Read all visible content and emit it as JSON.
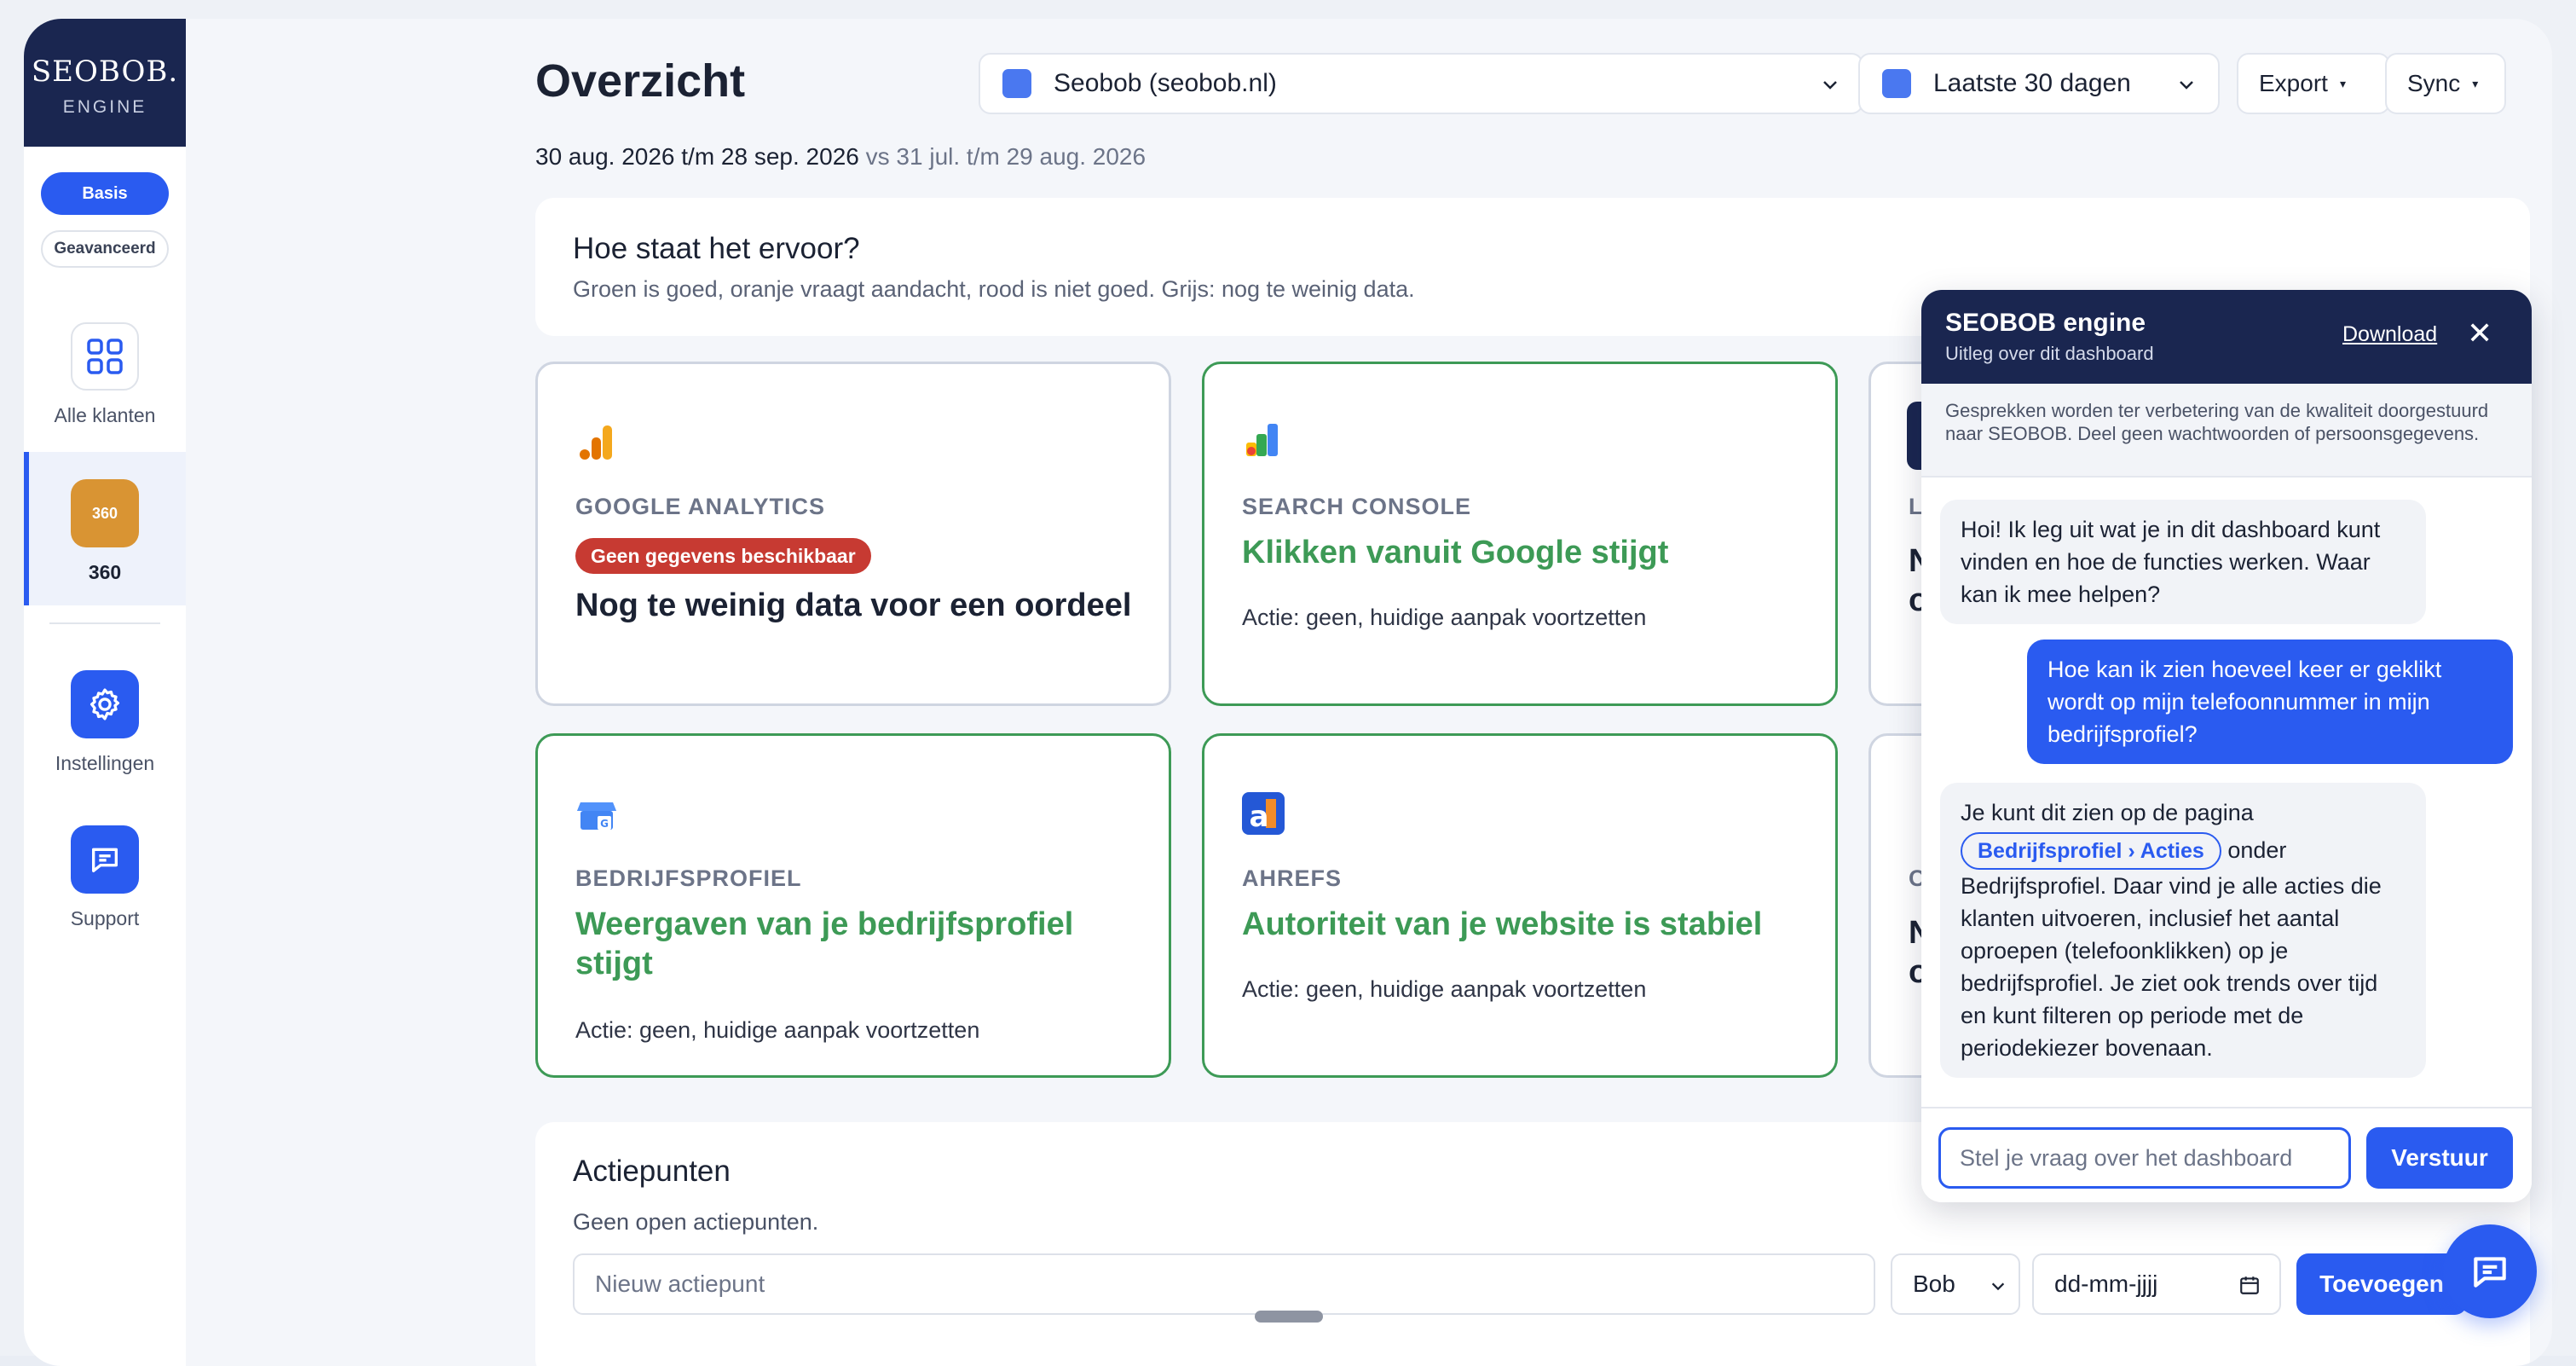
{
  "app": {
    "logo_title": "SEOBOB.",
    "logo_sub": "ENGINE"
  },
  "sidebar": {
    "mode_basic": "Basis",
    "mode_advanced": "Geavanceerd",
    "items": [
      {
        "label": "Alle klanten",
        "icon": "grid-icon"
      },
      {
        "label": "360",
        "badge": "360",
        "icon": "360-icon"
      },
      {
        "label": "Instellingen",
        "icon": "gear-icon"
      },
      {
        "label": "Support",
        "icon": "chat-icon"
      }
    ]
  },
  "header": {
    "title": "Overzicht",
    "date_range": "30 aug. 2026 t/m 28 sep. 2026",
    "date_compare": "vs 31 jul. t/m 29 aug. 2026",
    "site_select": "Seobob (seobob.nl)",
    "period_select": "Laatste 30 dagen",
    "export_label": "Export",
    "sync_label": "Sync"
  },
  "hero": {
    "title": "Hoe staat het ervoor?",
    "subtitle": "Groen is goed, oranje vraagt aandacht, rood is niet goed. Grijs: nog te weinig data."
  },
  "cards": [
    {
      "label": "GOOGLE ANALYTICS",
      "badge": "Geen gegevens beschikbaar",
      "headline": "Nog te weinig data voor een oordeel",
      "status": "grey"
    },
    {
      "label": "SEARCH CONSOLE",
      "headline": "Klikken vanuit Google stijgt",
      "action": "Actie: geen, huidige aanpak voortzetten",
      "status": "green"
    },
    {
      "label": "BEDRIJFSPROFIEL",
      "headline": "Weergaven van je bedrijfsprofiel stijgt",
      "action": "Actie: geen, huidige aanpak voortzetten",
      "status": "green"
    },
    {
      "label": "AHREFS",
      "headline": "Autoriteit van je website is stabiel",
      "action": "Actie: geen, huidige aanpak voortzetten",
      "status": "green"
    }
  ],
  "partial_cards": [
    {
      "label": "L",
      "headline_1": "N",
      "headline_2": "o"
    },
    {
      "label": "C",
      "headline_1": "N",
      "headline_2": "o"
    }
  ],
  "actions": {
    "title": "Actiepunten",
    "empty": "Geen open actiepunten.",
    "new_placeholder": "Nieuw actiepunt",
    "assignee": "Bob",
    "date_placeholder": "dd-mm-jjjj",
    "add_label": "Toevoegen"
  },
  "chat": {
    "title": "SEOBOB engine",
    "subtitle": "Uitleg over dit dashboard",
    "download": "Download",
    "close": "✕",
    "notice": "Gesprekken worden ter verbetering van de kwaliteit doorgestuurd naar SEOBOB. Deel geen wachtwoorden of persoonsgegevens.",
    "msg_bot_1": "Hoi! Ik leg uit wat je in dit dashboard kunt vinden en hoe de functies werken. Waar kan ik mee helpen?",
    "msg_user_1": "Hoe kan ik zien hoeveel keer er geklikt wordt op mijn telefoonnummer in mijn bedrijfsprofiel?",
    "msg_bot_2_intro": "Je kunt dit zien op de pagina",
    "msg_bot_2_link": "Bedrijfsprofiel › Acties",
    "msg_bot_2_after": "onder",
    "msg_bot_2_rest": "Bedrijfsprofiel. Daar vind je alle acties die klanten uitvoeren, inclusief het aantal oproepen (telefoonklikken) op je bedrijfsprofiel. Je ziet ook trends over tijd en kunt filteren op periode met de periodekiezer bovenaan.",
    "input_placeholder": "Stel je vraag over het dashboard",
    "send_label": "Verstuur"
  },
  "colors": {
    "accent": "#2a5bf0",
    "navy": "#1a2650",
    "good": "#3d9a56",
    "bad": "#c73a32"
  }
}
